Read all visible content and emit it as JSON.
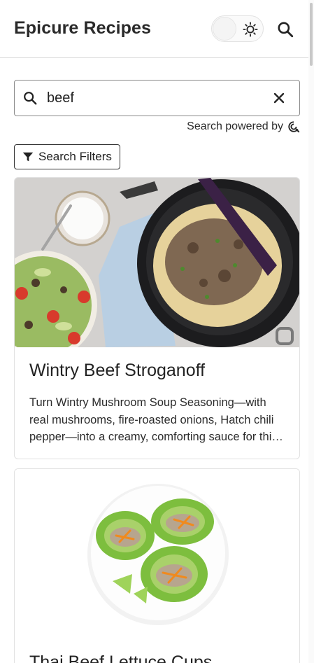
{
  "header": {
    "title": "Epicure Recipes",
    "theme_toggle_icon": "sun-icon",
    "search_icon": "search-icon"
  },
  "search": {
    "value": "beef",
    "placeholder": "",
    "clear_icon": "close-icon",
    "powered_by": "Search powered by",
    "powered_icon": "search-provider-logo"
  },
  "filters": {
    "label": "Search Filters",
    "icon": "filter-icon"
  },
  "results": [
    {
      "title": "Wintry Beef Stroganoff",
      "description": "Turn Wintry Mushroom Soup Seasoning—with real mushrooms, fire-roasted onions, Hatch chili pepper—into a creamy, comforting sauce for this beef stroganoff.",
      "image": "photo of beef stroganoff in a black skillet with a salad and sour cream"
    },
    {
      "title": "Thai Beef Lettuce Cups",
      "description": "",
      "image": "photo of lettuce cups on a white plate"
    }
  ],
  "colors": {
    "accent": "#222222",
    "border": "#dcdcdc",
    "skillet": "#1c1c1e",
    "tongs": "#3b2146"
  }
}
